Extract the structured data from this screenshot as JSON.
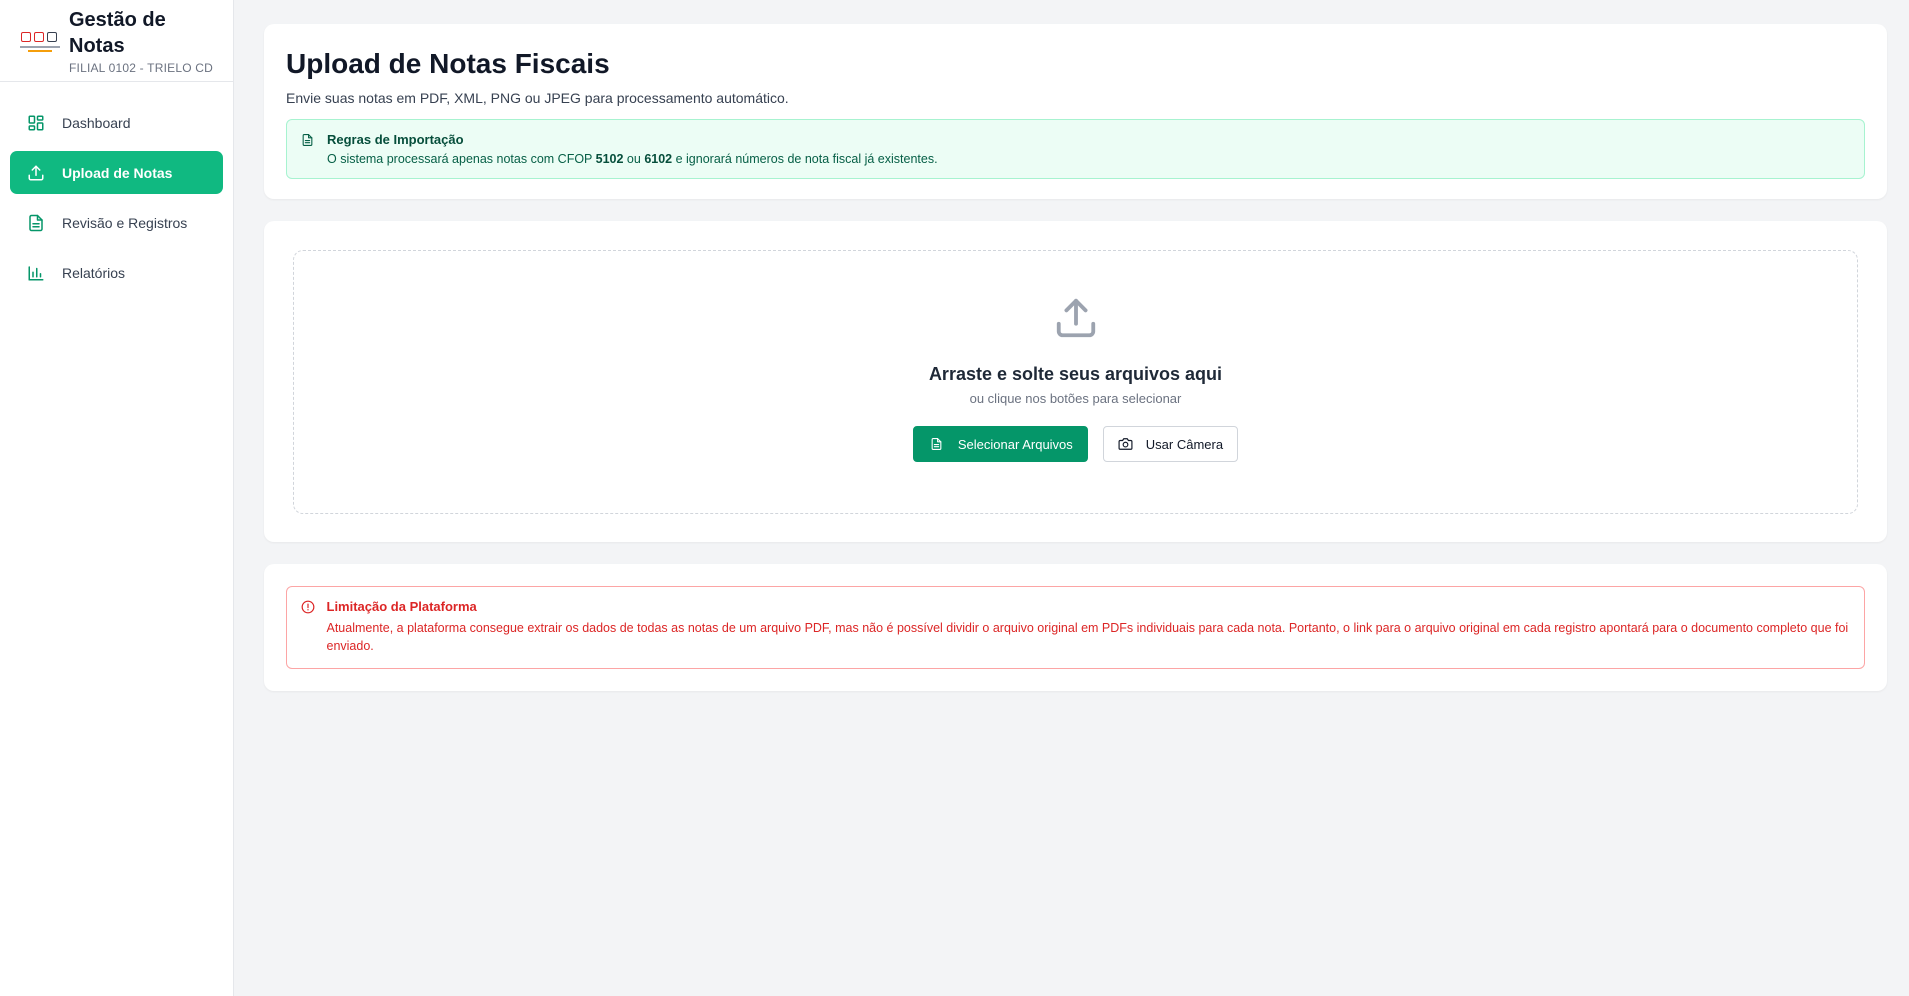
{
  "brand": {
    "title": "Gestão de Notas",
    "subtitle": "FILIAL 0102 - TRIELO CD"
  },
  "sidebar": {
    "items": [
      {
        "label": "Dashboard",
        "icon": "dashboard-icon",
        "active": false
      },
      {
        "label": "Upload de Notas",
        "icon": "upload-icon",
        "active": true
      },
      {
        "label": "Revisão e Registros",
        "icon": "document-icon",
        "active": false
      },
      {
        "label": "Relatórios",
        "icon": "bar-chart-icon",
        "active": false
      }
    ]
  },
  "header": {
    "title": "Upload de Notas Fiscais",
    "subtitle": "Envie suas notas em PDF, XML, PNG ou JPEG para processamento automático."
  },
  "import_rules": {
    "title": "Regras de Importação",
    "text_before": "O sistema processará apenas notas com CFOP ",
    "cfop_1": "5102",
    "text_middle": " ou ",
    "cfop_2": "6102",
    "text_after": " e ignorará números de nota fiscal já existentes."
  },
  "dropzone": {
    "title": "Arraste e solte seus arquivos aqui",
    "subtitle": "ou clique nos botões para selecionar",
    "select_button": "Selecionar Arquivos",
    "camera_button": "Usar Câmera"
  },
  "limitation": {
    "title": "Limitação da Plataforma",
    "text": "Atualmente, a plataforma consegue extrair os dados de todas as notas de um arquivo PDF, mas não é possível dividir o arquivo original em PDFs individuais para cada nota. Portanto, o link para o arquivo original em cada registro apontará para o documento completo que foi enviado."
  },
  "colors": {
    "accent": "#10b981",
    "primary_button": "#059669",
    "info_bg": "#ecfdf5",
    "warning": "#dc2626"
  }
}
